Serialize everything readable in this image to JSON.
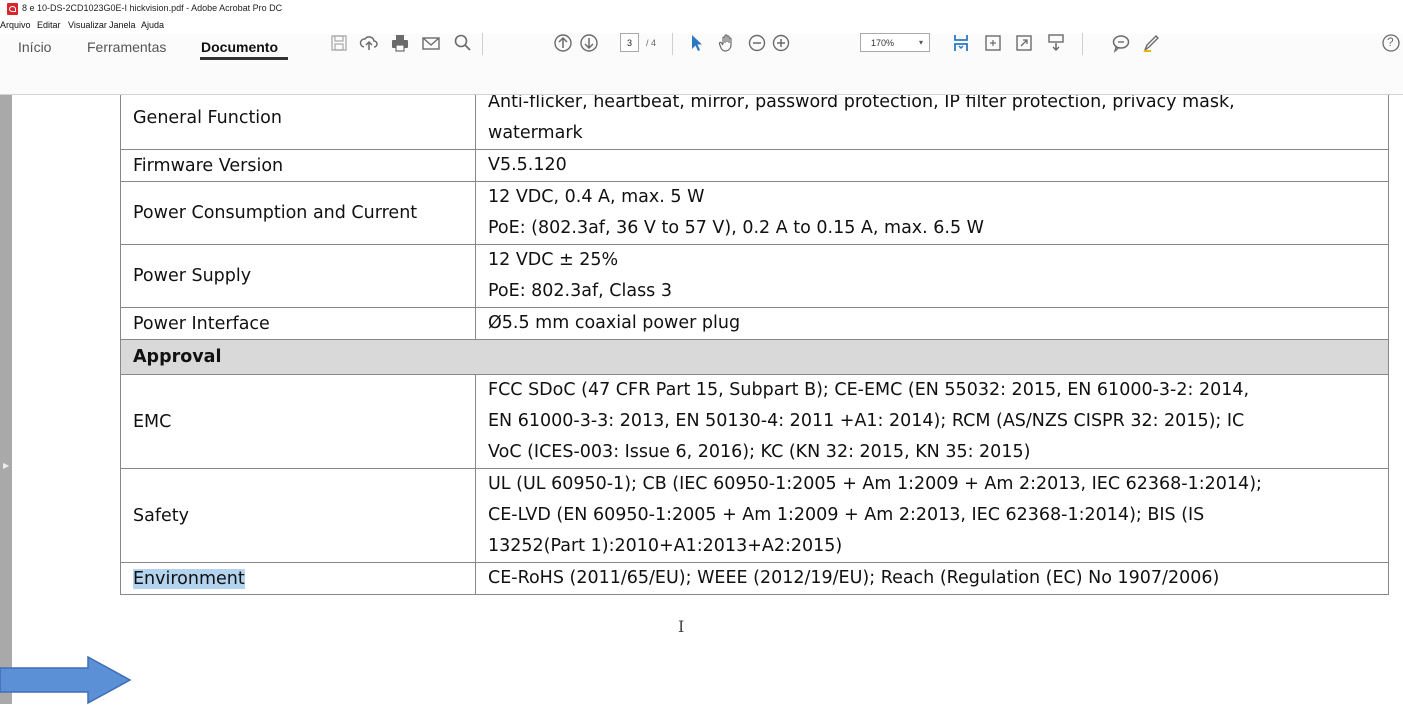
{
  "window": {
    "title": "8 e 10-DS-2CD1023G0E-I hickvision.pdf - Adobe Acrobat Pro DC"
  },
  "menu": [
    "Arquivo",
    "Editar",
    "Visualizar",
    "Janela",
    "Ajuda"
  ],
  "tabs": [
    "Início",
    "Ferramentas",
    "Documento"
  ],
  "toolbar": {
    "page_current": "3",
    "page_total": "/ 4",
    "zoom": "170%",
    "zoom_caret": "▾",
    "help": "?"
  },
  "table": {
    "rows": [
      {
        "key": "General Function",
        "values": [
          "Anti-flicker, heartbeat, mirror, password protection, IP filter protection, privacy mask,",
          "watermark"
        ]
      },
      {
        "key": "Firmware Version",
        "values": [
          "V5.5.120"
        ]
      },
      {
        "key": "Power Consumption and Current",
        "values": [
          "12 VDC, 0.4 A, max. 5 W",
          "PoE: (802.3af, 36 V to 57 V), 0.2 A to 0.15 A, max. 6.5 W"
        ]
      },
      {
        "key": "Power Supply",
        "values": [
          "12 VDC ± 25%",
          "PoE: 802.3af, Class 3"
        ]
      },
      {
        "key": "Power Interface",
        "values": [
          "Ø5.5 mm coaxial power plug"
        ]
      }
    ],
    "section": "Approval",
    "approval_rows": [
      {
        "key": "EMC",
        "values": [
          "FCC SDoC (47 CFR Part 15, Subpart B); CE-EMC (EN 55032: 2015, EN 61000-3-2: 2014,",
          "EN 61000-3-3: 2013, EN 50130-4: 2011 +A1: 2014); RCM (AS/NZS CISPR 32: 2015); IC",
          "VoC (ICES-003: Issue 6, 2016); KC (KN 32: 2015, KN 35: 2015)"
        ]
      },
      {
        "key": "Safety",
        "values": [
          "UL (UL 60950-1); CB (IEC 60950-1:2005 + Am 1:2009 + Am 2:2013, IEC 62368-1:2014);",
          "CE-LVD (EN 60950-1:2005 + Am 1:2009 + Am 2:2013, IEC 62368-1:2014); BIS (IS",
          "13252(Part 1):2010+A1:2013+A2:2015)"
        ]
      },
      {
        "key": "Environment",
        "values": [
          "CE-RoHS (2011/65/EU); WEEE (2012/19/EU); Reach (Regulation (EC) No 1907/2006)"
        ]
      }
    ]
  },
  "icons": [
    "pdf-file-icon",
    "save-icon",
    "upload-icon",
    "print-icon",
    "email-icon",
    "search-icon",
    "page-up-icon",
    "page-down-icon",
    "select-arrow-icon",
    "hand-tool-icon",
    "zoom-out-icon",
    "zoom-in-icon",
    "fit-page-icon",
    "fit-width-icon",
    "full-screen-icon",
    "scroll-mode-icon",
    "comment-icon",
    "highlight-pen-icon",
    "help-icon",
    "arrow-annotation-icon"
  ],
  "colors": {
    "arrow": "#5b8fd6",
    "selection": "#b3d3ee",
    "section_bg": "#d9d9d9",
    "accent": "#2b79c2"
  }
}
